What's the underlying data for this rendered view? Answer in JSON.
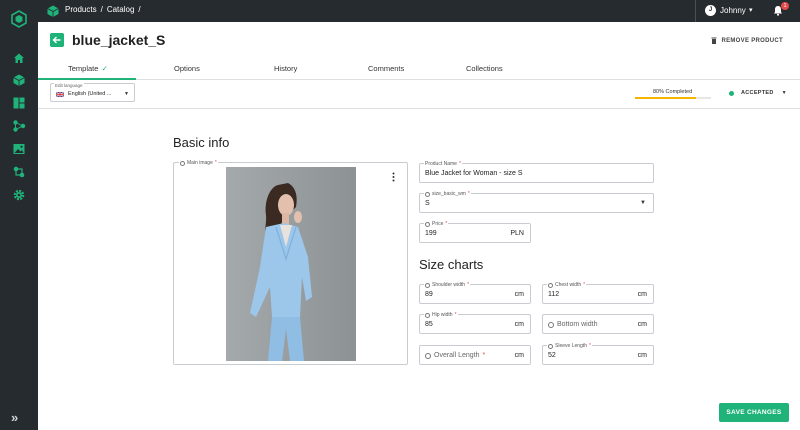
{
  "breadcrumbs": [
    "Products",
    "Catalog"
  ],
  "user": {
    "name": "Johnny",
    "initial": "J",
    "notification_count": "1"
  },
  "page": {
    "title": "blue_jacket_S",
    "remove_label": "REMOVE PRODUCT"
  },
  "tabs": [
    {
      "label": "Template",
      "active": true,
      "check": "✓"
    },
    {
      "label": "Options"
    },
    {
      "label": "History"
    },
    {
      "label": "Comments"
    },
    {
      "label": "Collections"
    }
  ],
  "language": {
    "label": "Edit language",
    "value": "English (United ..."
  },
  "progress": {
    "label": "80% Completed",
    "fraction": 0.8,
    "color": "#f5b400"
  },
  "status": {
    "label": "ACCEPTED",
    "color": "#1fb37a"
  },
  "basic_info": {
    "title": "Basic info",
    "main_image_label": "Main image",
    "product_name": {
      "label": "Product Name",
      "value": "Blue Jacket for Woman - size S"
    },
    "size": {
      "label": "size_basic_wm",
      "value": "S"
    },
    "price": {
      "label": "Price",
      "value": "199",
      "unit": "PLN"
    }
  },
  "size_charts": {
    "title": "Size charts",
    "shoulder_width": {
      "label": "Shoulder width",
      "value": "89",
      "unit": "cm"
    },
    "chest_width": {
      "label": "Chest width",
      "value": "112",
      "unit": "cm"
    },
    "hip_width": {
      "label": "Hip width",
      "value": "85",
      "unit": "cm"
    },
    "bottom_width": {
      "placeholder": "Bottom width",
      "unit": "cm"
    },
    "overall_length": {
      "placeholder": "Overall Length",
      "unit": "cm"
    },
    "sleeve_length": {
      "label": "Sleeve Length",
      "value": "52",
      "unit": "cm"
    }
  },
  "save_label": "SAVE CHANGES",
  "accent_color": "#1fb37a"
}
